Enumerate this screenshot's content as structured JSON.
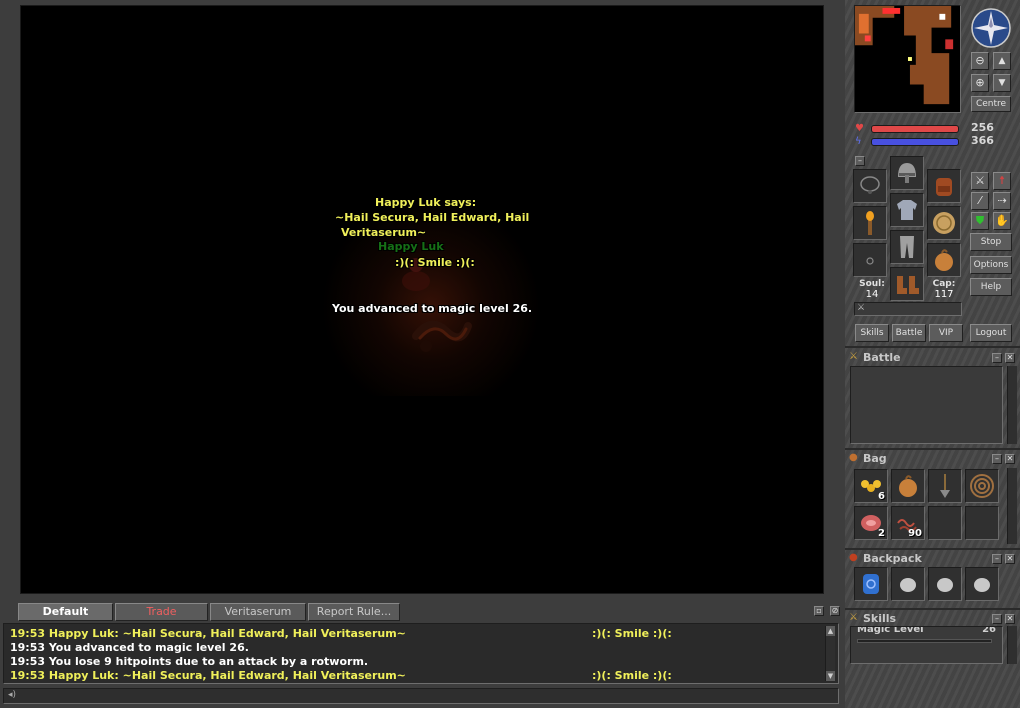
{
  "viewport": {
    "speech_header": "Happy Luk says:",
    "speech_line1": "~Hail Secura, Hail Edward, Hail",
    "speech_line2": "Veritaserum~",
    "creature_name": "Happy Luk",
    "emote": ":)(:  Smile  :)(:",
    "status_message": "You advanced to magic level 26."
  },
  "chat": {
    "tabs": [
      {
        "label": "Default"
      },
      {
        "label": "Trade"
      },
      {
        "label": "Veritaserum"
      },
      {
        "label": "Report Rule..."
      }
    ],
    "lines": [
      {
        "text": "19:53 Happy Luk: ~Hail Secura, Hail Edward, Hail Veritaserum~",
        "right": ":)(:  Smile  :)(:",
        "color": "#f0f05a"
      },
      {
        "text": "19:53 You advanced to magic level 26.",
        "right": "",
        "color": "#ffffff"
      },
      {
        "text": "19:53 You lose 9 hitpoints due to an attack by a rotworm.",
        "right": "",
        "color": "#ffffff"
      },
      {
        "text": "19:53 Happy Luk: ~Hail Secura, Hail Edward, Hail Veritaserum~",
        "right": ":)(:  Smile  :)(:",
        "color": "#f0f05a"
      }
    ],
    "input_value": ""
  },
  "minimap": {
    "centre_label": "Centre"
  },
  "stats": {
    "hitpoints": "256",
    "mana": "366",
    "health_color": "#e04848",
    "mana_color": "#4850e0"
  },
  "equipment": {
    "soul_label": "Soul:",
    "soul_value": "14",
    "cap_label": "Cap:",
    "cap_value": "117"
  },
  "controls": {
    "stop": "Stop",
    "options": "Options",
    "help": "Help",
    "skills": "Skills",
    "battle": "Battle",
    "vip": "VIP",
    "logout": "Logout"
  },
  "windows": {
    "battle_title": "Battle",
    "bag_title": "Bag",
    "backpack_title": "Backpack",
    "skills_title": "Skills",
    "skill_name": "Magic Level",
    "skill_value": "26"
  },
  "bag_items": [
    {
      "icon": "gold-coins-icon",
      "count": "6"
    },
    {
      "icon": "bread-roll-icon",
      "count": ""
    },
    {
      "icon": "shovel-icon",
      "count": ""
    },
    {
      "icon": "rope-icon",
      "count": ""
    },
    {
      "icon": "meat-icon",
      "count": "2"
    },
    {
      "icon": "worms-icon",
      "count": "90"
    },
    {
      "icon": "empty-slot",
      "count": ""
    },
    {
      "icon": "empty-slot",
      "count": ""
    }
  ],
  "backpack_items": [
    {
      "icon": "blue-rune-icon"
    },
    {
      "icon": "stone-icon"
    },
    {
      "icon": "stone-icon"
    },
    {
      "icon": "stone-icon"
    }
  ]
}
